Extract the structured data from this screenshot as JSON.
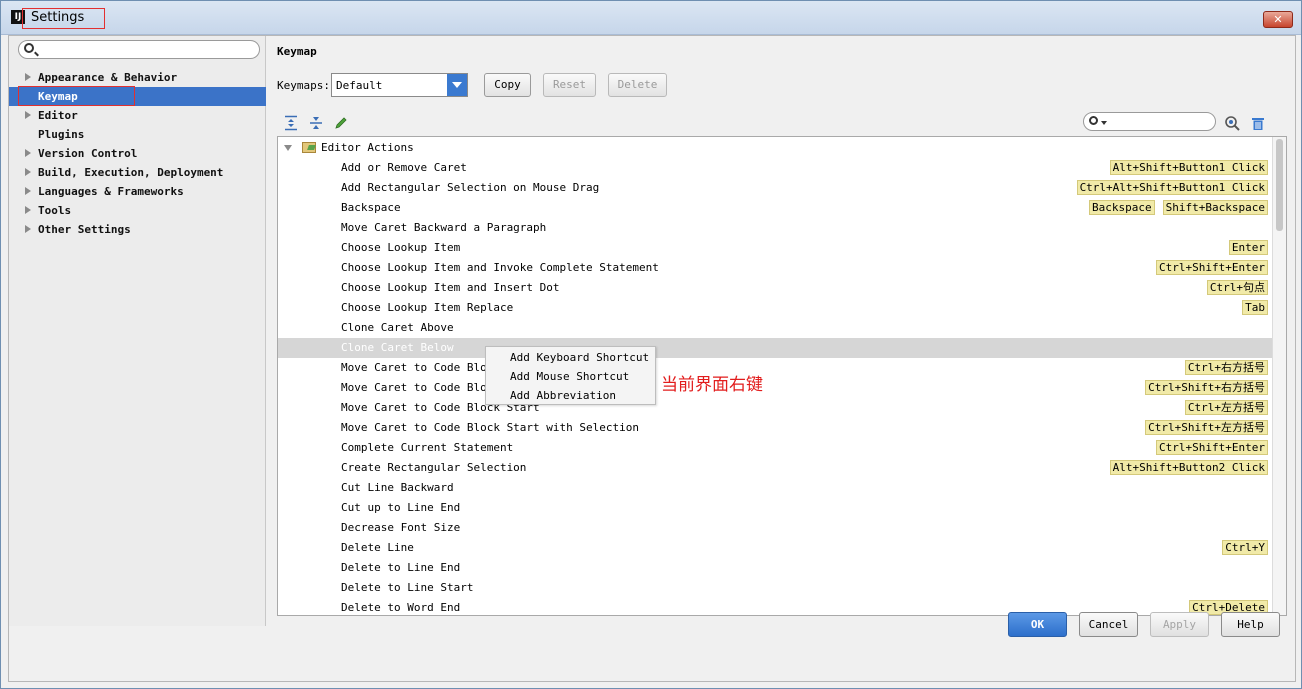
{
  "window": {
    "title": "Settings",
    "close_glyph": "✕"
  },
  "sidebar": {
    "search_placeholder": "",
    "items": [
      {
        "label": "Appearance & Behavior",
        "expandable": true
      },
      {
        "label": "Keymap",
        "expandable": false,
        "selected": true
      },
      {
        "label": "Editor",
        "expandable": true
      },
      {
        "label": "Plugins",
        "expandable": false
      },
      {
        "label": "Version Control",
        "expandable": true
      },
      {
        "label": "Build, Execution, Deployment",
        "expandable": true
      },
      {
        "label": "Languages & Frameworks",
        "expandable": true
      },
      {
        "label": "Tools",
        "expandable": true
      },
      {
        "label": "Other Settings",
        "expandable": true
      }
    ]
  },
  "keymap": {
    "title": "Keymap",
    "select_label": "Keymaps:",
    "selected_keymap": "Default",
    "copy": "Copy",
    "reset": "Reset",
    "delete": "Delete",
    "filter_placeholder": ""
  },
  "toolbar_icons": [
    "expand-all-icon",
    "collapse-all-icon",
    "edit-icon",
    "find-shortcut-icon",
    "trash-icon"
  ],
  "tree": {
    "root": "Editor Actions",
    "rows": [
      {
        "name": "Add or Remove Caret",
        "shortcuts": [
          "Alt+Shift+Button1 Click"
        ]
      },
      {
        "name": "Add Rectangular Selection on Mouse Drag",
        "shortcuts": [
          "Ctrl+Alt+Shift+Button1 Click"
        ]
      },
      {
        "name": "Backspace",
        "shortcuts": [
          "Backspace",
          "Shift+Backspace"
        ]
      },
      {
        "name": "Move Caret Backward a Paragraph",
        "shortcuts": []
      },
      {
        "name": "Choose Lookup Item",
        "shortcuts": [
          "Enter"
        ]
      },
      {
        "name": "Choose Lookup Item and Invoke Complete Statement",
        "shortcuts": [
          "Ctrl+Shift+Enter"
        ]
      },
      {
        "name": "Choose Lookup Item and Insert Dot",
        "shortcuts": [
          "Ctrl+句点"
        ]
      },
      {
        "name": "Choose Lookup Item Replace",
        "shortcuts": [
          "Tab"
        ]
      },
      {
        "name": "Clone Caret Above",
        "shortcuts": []
      },
      {
        "name": "Clone Caret Below",
        "shortcuts": [],
        "highlighted": true
      },
      {
        "name": "Move Caret to Code Block",
        "shortcuts": [
          "Ctrl+右方括号"
        ]
      },
      {
        "name": "Move Caret to Code Block",
        "shortcuts": [
          "Ctrl+Shift+右方括号"
        ]
      },
      {
        "name": "Move Caret to Code Block Start",
        "shortcuts": [
          "Ctrl+左方括号"
        ]
      },
      {
        "name": "Move Caret to Code Block Start with Selection",
        "shortcuts": [
          "Ctrl+Shift+左方括号"
        ]
      },
      {
        "name": "Complete Current Statement",
        "shortcuts": [
          "Ctrl+Shift+Enter"
        ]
      },
      {
        "name": "Create Rectangular Selection",
        "shortcuts": [
          "Alt+Shift+Button2 Click"
        ]
      },
      {
        "name": "Cut Line Backward",
        "shortcuts": []
      },
      {
        "name": "Cut up to Line End",
        "shortcuts": []
      },
      {
        "name": "Decrease Font Size",
        "shortcuts": []
      },
      {
        "name": "Delete Line",
        "shortcuts": [
          "Ctrl+Y"
        ]
      },
      {
        "name": "Delete to Line End",
        "shortcuts": []
      },
      {
        "name": "Delete to Line Start",
        "shortcuts": []
      },
      {
        "name": "Delete to Word End",
        "shortcuts": [
          "Ctrl+Delete"
        ]
      }
    ]
  },
  "context_menu": {
    "items": [
      "Add Keyboard Shortcut",
      "Add Mouse Shortcut",
      "Add Abbreviation"
    ]
  },
  "annotation": {
    "text": "当前界面右键",
    "color": "#e21d1d"
  },
  "footer": {
    "ok": "OK",
    "cancel": "Cancel",
    "apply": "Apply",
    "help": "Help"
  },
  "colors": {
    "selection": "#3b73c8",
    "shortcut_bg": "#f1eaa8",
    "annotation_border": "#e23030"
  }
}
